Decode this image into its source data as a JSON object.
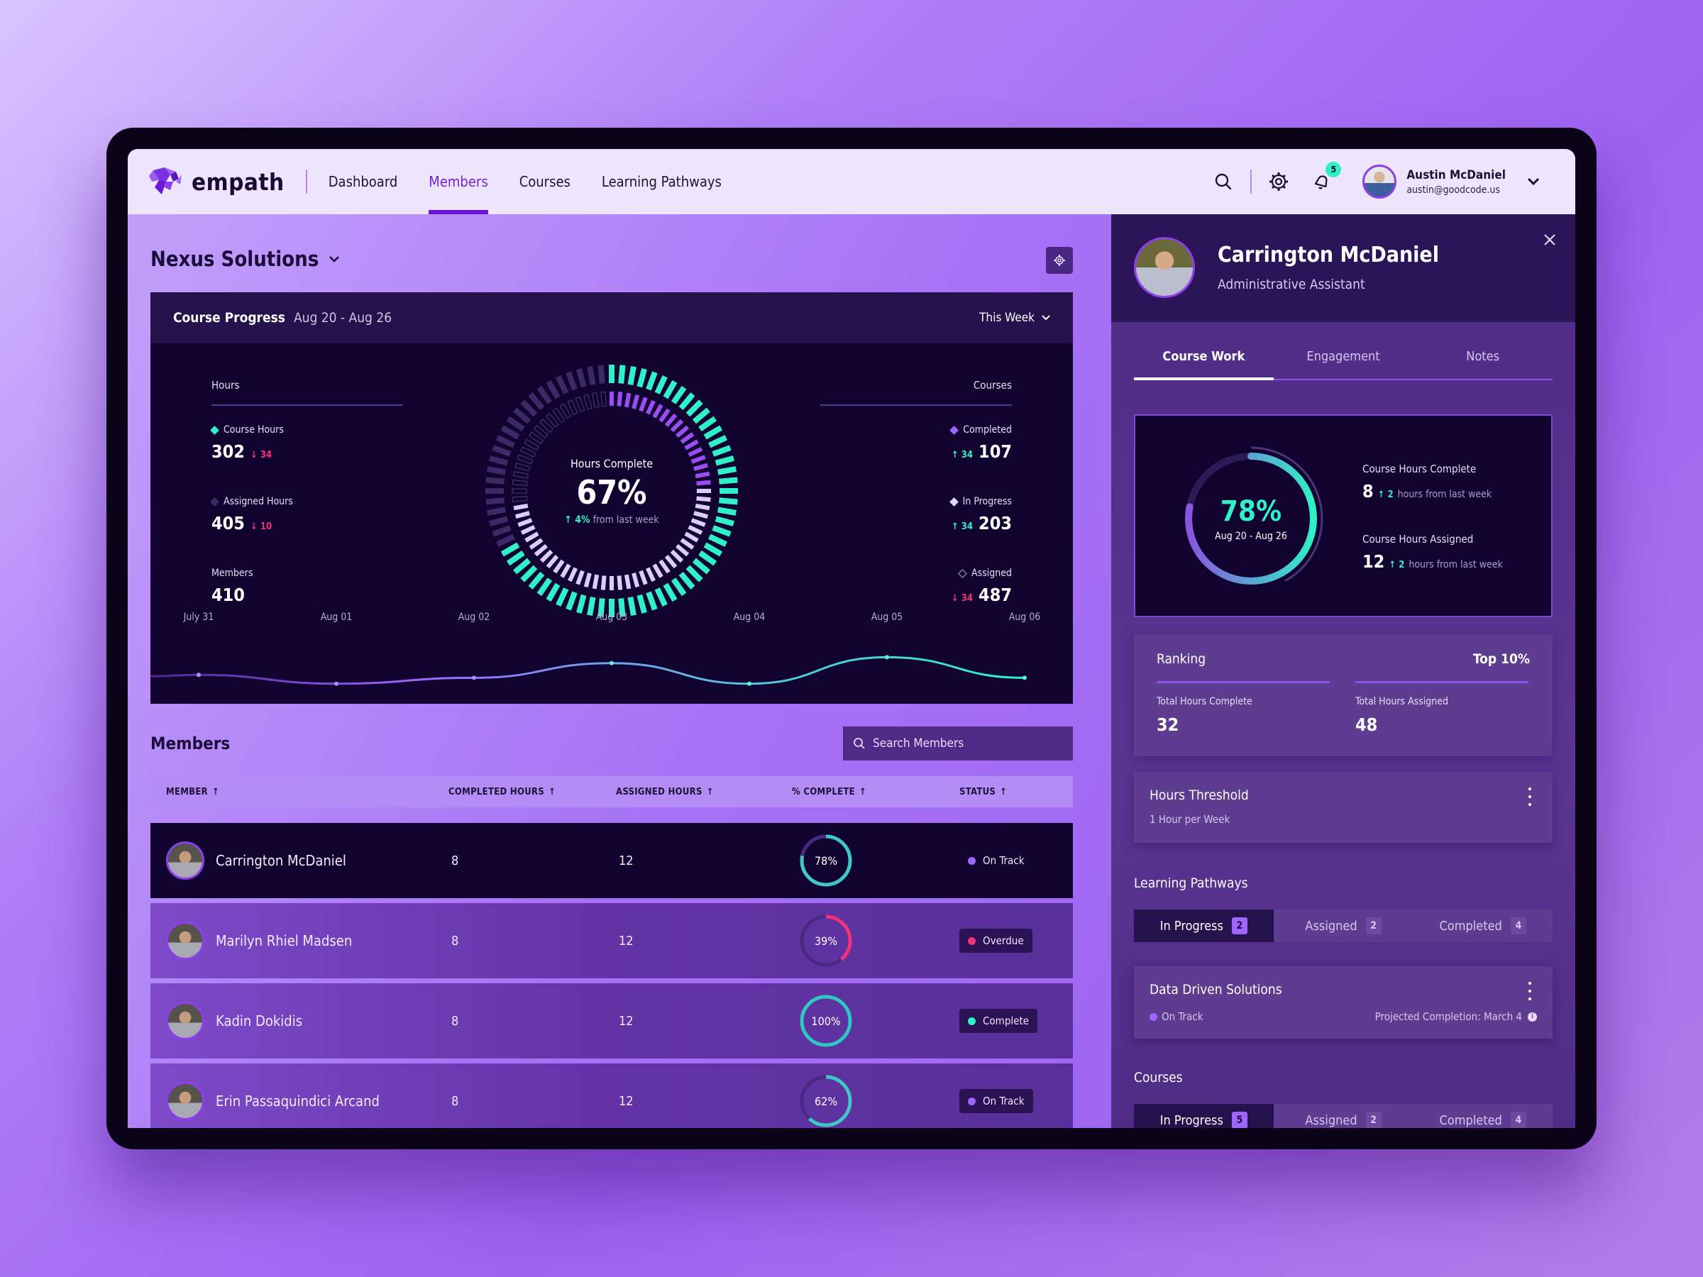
{
  "nav": {
    "brand": "empath",
    "items": [
      {
        "label": "Dashboard",
        "active": false
      },
      {
        "label": "Members",
        "active": true
      },
      {
        "label": "Courses",
        "active": false
      },
      {
        "label": "Learning Pathways",
        "active": false
      }
    ],
    "icons": [
      "search-icon",
      "gear-icon",
      "bell-icon"
    ],
    "notification_count": "5",
    "user": {
      "name": "Austin McDaniel",
      "email": "austin@goodcode.us"
    }
  },
  "company": {
    "name": "Nexus Solutions"
  },
  "course_progress": {
    "title": "Course Progress",
    "date_range": "Aug 20 - Aug 26",
    "range_select": "This Week",
    "hours": {
      "title": "Hours",
      "course_hours": {
        "label": "Course Hours",
        "value": "302",
        "delta": "34",
        "direction": "down"
      },
      "assigned_hours": {
        "label": "Assigned Hours",
        "value": "405",
        "delta": "10",
        "direction": "down"
      },
      "members": {
        "label": "Members",
        "value": "410"
      }
    },
    "courses": {
      "title": "Courses",
      "completed": {
        "label": "Completed",
        "value": "107",
        "delta": "34",
        "direction": "up"
      },
      "in_progress": {
        "label": "In Progress",
        "value": "203",
        "delta": "34",
        "direction": "up"
      },
      "assigned": {
        "label": "Assigned",
        "value": "487",
        "delta": "34",
        "direction": "down"
      }
    },
    "donut": {
      "label": "Hours Complete",
      "value": "67%",
      "value_fraction": 0.67,
      "inner_fraction": 0.73,
      "change": "4%",
      "change_text": "from last week"
    }
  },
  "chart_data": {
    "type": "line",
    "x": [
      "July 31",
      "Aug 01",
      "Aug 02",
      "Aug 03",
      "Aug 04",
      "Aug 05",
      "Aug 06"
    ],
    "series": [
      {
        "name": "Hours",
        "values": [
          5,
          2,
          4,
          9,
          2,
          11,
          4
        ]
      }
    ],
    "ylim": [
      0,
      14
    ],
    "grid": false,
    "title": "",
    "xlabel": "",
    "ylabel": ""
  },
  "members": {
    "title": "Members",
    "search_placeholder": "Search Members",
    "columns": [
      "MEMBER",
      "COMPLETED HOURS",
      "ASSIGNED HOURS",
      "% COMPLETE",
      "STATUS"
    ],
    "rows": [
      {
        "name": "Carrington McDaniel",
        "completed": "8",
        "assigned": "12",
        "percent": "78%",
        "fraction": 0.78,
        "status": "On Track",
        "status_color": "#a064ff",
        "selected": true
      },
      {
        "name": "Marilyn Rhiel Madsen",
        "completed": "8",
        "assigned": "12",
        "percent": "39%",
        "fraction": 0.39,
        "status": "Overdue",
        "status_color": "#f2337a",
        "selected": false
      },
      {
        "name": "Kadin Dokidis",
        "completed": "8",
        "assigned": "12",
        "percent": "100%",
        "fraction": 1.0,
        "status": "Complete",
        "status_color": "#2ff0c7",
        "selected": false
      },
      {
        "name": "Erin Passaquindici Arcand",
        "completed": "8",
        "assigned": "12",
        "percent": "62%",
        "fraction": 0.62,
        "status": "On Track",
        "status_color": "#a064ff",
        "selected": false
      }
    ]
  },
  "panel": {
    "name": "Carrington McDaniel",
    "role": "Administrative Assistant",
    "tabs": [
      {
        "label": "Course Work",
        "active": true
      },
      {
        "label": "Engagement",
        "active": false
      },
      {
        "label": "Notes",
        "active": false
      }
    ],
    "ring": {
      "value": "78%",
      "fraction": 0.78,
      "date": "Aug 20 - Aug 26"
    },
    "hours_complete": {
      "label": "Course Hours Complete",
      "value": "8",
      "delta": "2",
      "text": "hours from last week"
    },
    "hours_assigned": {
      "label": "Course Hours Assigned",
      "value": "12",
      "delta": "2",
      "text": "hours from last week"
    },
    "ranking": {
      "title": "Ranking",
      "value": "Top 10%",
      "total_complete_label": "Total Hours Complete",
      "total_complete": "32",
      "total_assigned_label": "Total Hours Assigned",
      "total_assigned": "48"
    },
    "threshold": {
      "title": "Hours Threshold",
      "value": "1 Hour per Week"
    },
    "learning_pathways": {
      "title": "Learning Pathways",
      "tabs": [
        {
          "label": "In Progress",
          "count": "2",
          "active": true
        },
        {
          "label": "Assigned",
          "count": "2",
          "active": false
        },
        {
          "label": "Completed",
          "count": "4",
          "active": false
        }
      ],
      "item": {
        "title": "Data Driven Solutions",
        "status": "On Track",
        "projected": "Projected Completion: March 4"
      }
    },
    "courses": {
      "title": "Courses",
      "tabs": [
        {
          "label": "In Progress",
          "count": "5",
          "active": true
        },
        {
          "label": "Assigned",
          "count": "2",
          "active": false
        },
        {
          "label": "Completed",
          "count": "4",
          "active": false
        }
      ]
    }
  },
  "colors": {
    "accent": "#6b16d9",
    "teal": "#2ff0c7",
    "pink": "#f2337a",
    "purple": "#a064ff",
    "dark": "#110330"
  }
}
